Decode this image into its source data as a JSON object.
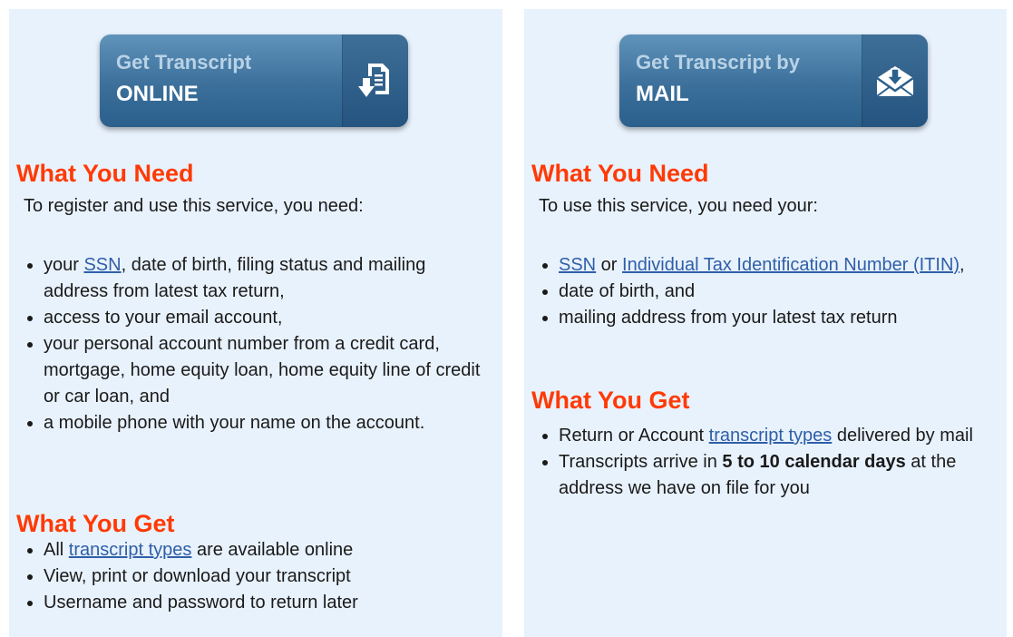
{
  "online_panel": {
    "button": {
      "line1": "Get Transcript",
      "line2": "ONLINE",
      "icon": "document-download-icon"
    },
    "need_heading": "What You Need",
    "need_intro": "To register and use this service, you need:",
    "need_items": [
      {
        "before": "your ",
        "link": "SSN",
        "after": ", date of birth, filing status and mailing address from latest tax return,"
      },
      {
        "text": "access to your email account,"
      },
      {
        "text": "your personal account number from a credit card, mortgage, home equity loan, home equity line of credit or car loan, and"
      },
      {
        "text": "a mobile phone with your name on the account."
      }
    ],
    "get_heading": "What You Get",
    "get_items": [
      {
        "before": "All ",
        "link": "transcript types",
        "after": " are available online"
      },
      {
        "text": "View, print or download your transcript"
      },
      {
        "text": "Username and password to return later"
      }
    ]
  },
  "mail_panel": {
    "button": {
      "line1": "Get Transcript by",
      "line2": "MAIL",
      "icon": "envelope-download-icon"
    },
    "need_heading": "What You Need",
    "need_intro": "To use this service, you need your:",
    "need_items": [
      {
        "link1": "SSN",
        "mid": " or ",
        "link2": "Individual Tax Identification Number (ITIN)",
        "after": ","
      },
      {
        "text": "date of birth, and"
      },
      {
        "text": "mailing address from your latest tax return"
      }
    ],
    "get_heading": "What You Get",
    "get_items": [
      {
        "before": "Return or Account ",
        "link": "transcript types",
        "after": " delivered by mail"
      },
      {
        "before": "Transcripts arrive in ",
        "bold": "5 to 10 calendar days",
        "after": " at the address we have on file for you"
      }
    ]
  },
  "colors": {
    "heading": "#ff3a05",
    "link": "#2f5fa8",
    "panel_bg": "#e8f2fc",
    "button": "#3c709b"
  }
}
